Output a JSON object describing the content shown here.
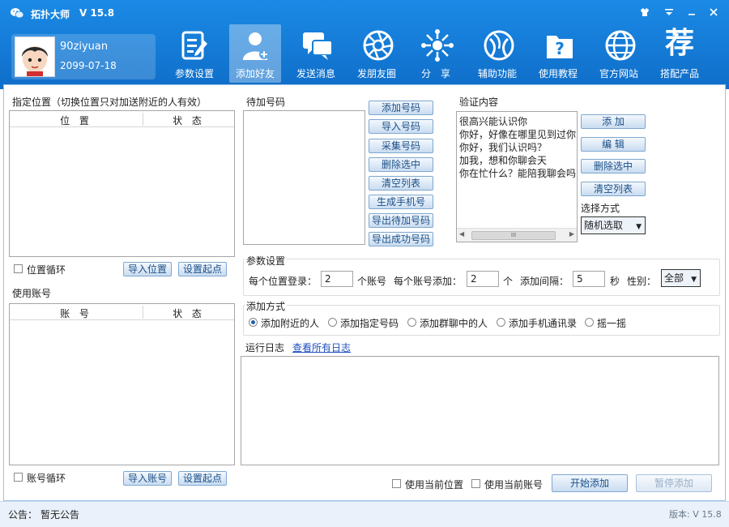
{
  "app": {
    "name": "拓扑大师",
    "version": "V 15.8"
  },
  "user": {
    "name": "90ziyuan",
    "expire": "2099-07-18"
  },
  "nav": [
    {
      "label": "参数设置",
      "icon": "settings-doc-icon"
    },
    {
      "label": "添加好友",
      "icon": "add-friend-icon"
    },
    {
      "label": "发送消息",
      "icon": "chat-icon"
    },
    {
      "label": "发朋友圈",
      "icon": "moments-icon"
    },
    {
      "label": "分　享",
      "icon": "share-icon"
    },
    {
      "label": "辅助功能",
      "icon": "helper-icon"
    },
    {
      "label": "使用教程",
      "icon": "tutorial-icon"
    },
    {
      "label": "官方网站",
      "icon": "globe-icon"
    },
    {
      "label": "搭配产品",
      "icon": "product-icon"
    }
  ],
  "nav_icon_char": "荐",
  "location": {
    "title": "指定位置（切换位置只对加送附近的人有效）",
    "col_pos": "位 置",
    "col_status": "状 态",
    "loop_label": "位置循环",
    "import_btn": "导入位置",
    "set_start_btn": "设置起点"
  },
  "accounts": {
    "title": "使用账号",
    "col_account": "账 号",
    "col_status": "状 态",
    "loop_label": "账号循环",
    "import_btn": "导入账号",
    "set_start_btn": "设置起点"
  },
  "pending": {
    "title": "待加号码",
    "buttons": [
      "添加号码",
      "导入号码",
      "采集号码",
      "删除选中",
      "清空列表",
      "生成手机号",
      "导出待加号码",
      "导出成功号码"
    ]
  },
  "verify": {
    "title": "验证内容",
    "lines": [
      "很高兴能认识你",
      "你好，好像在哪里见到过你",
      "你好，我们认识吗？",
      "加我，想和你聊会天",
      "你在忙什么？能陪我聊会吗"
    ],
    "buttons": [
      "添 加",
      "编 辑",
      "删除选中",
      "清空列表"
    ],
    "mode_label": "选择方式",
    "mode_value": "随机选取",
    "scroll_glyph": "III"
  },
  "params": {
    "title": "参数设置",
    "per_loc_label": "每个位置登录：",
    "per_loc_value": "2",
    "per_loc_unit": "个账号",
    "per_acc_label": "每个账号添加：",
    "per_acc_value": "2",
    "per_acc_unit": "个",
    "interval_label": "添加间隔：",
    "interval_value": "5",
    "interval_unit": "秒",
    "gender_label": "性别：",
    "gender_value": "全部"
  },
  "add_mode": {
    "title": "添加方式",
    "options": [
      "添加附近的人",
      "添加指定号码",
      "添加群聊中的人",
      "添加手机通讯录",
      "摇一摇"
    ],
    "selected": 0
  },
  "log": {
    "title": "运行日志",
    "view_all": "查看所有日志"
  },
  "bottom": {
    "use_current_location": "使用当前位置",
    "use_current_account": "使用当前账号",
    "start_btn": "开始添加",
    "pause_btn": "暂停添加"
  },
  "status": {
    "notice_label": "公告：",
    "notice_value": "暂无公告",
    "version": "版本: V 15.8"
  },
  "colors": {
    "accent": "#1a7fd8",
    "button_text": "#1b4f88"
  }
}
